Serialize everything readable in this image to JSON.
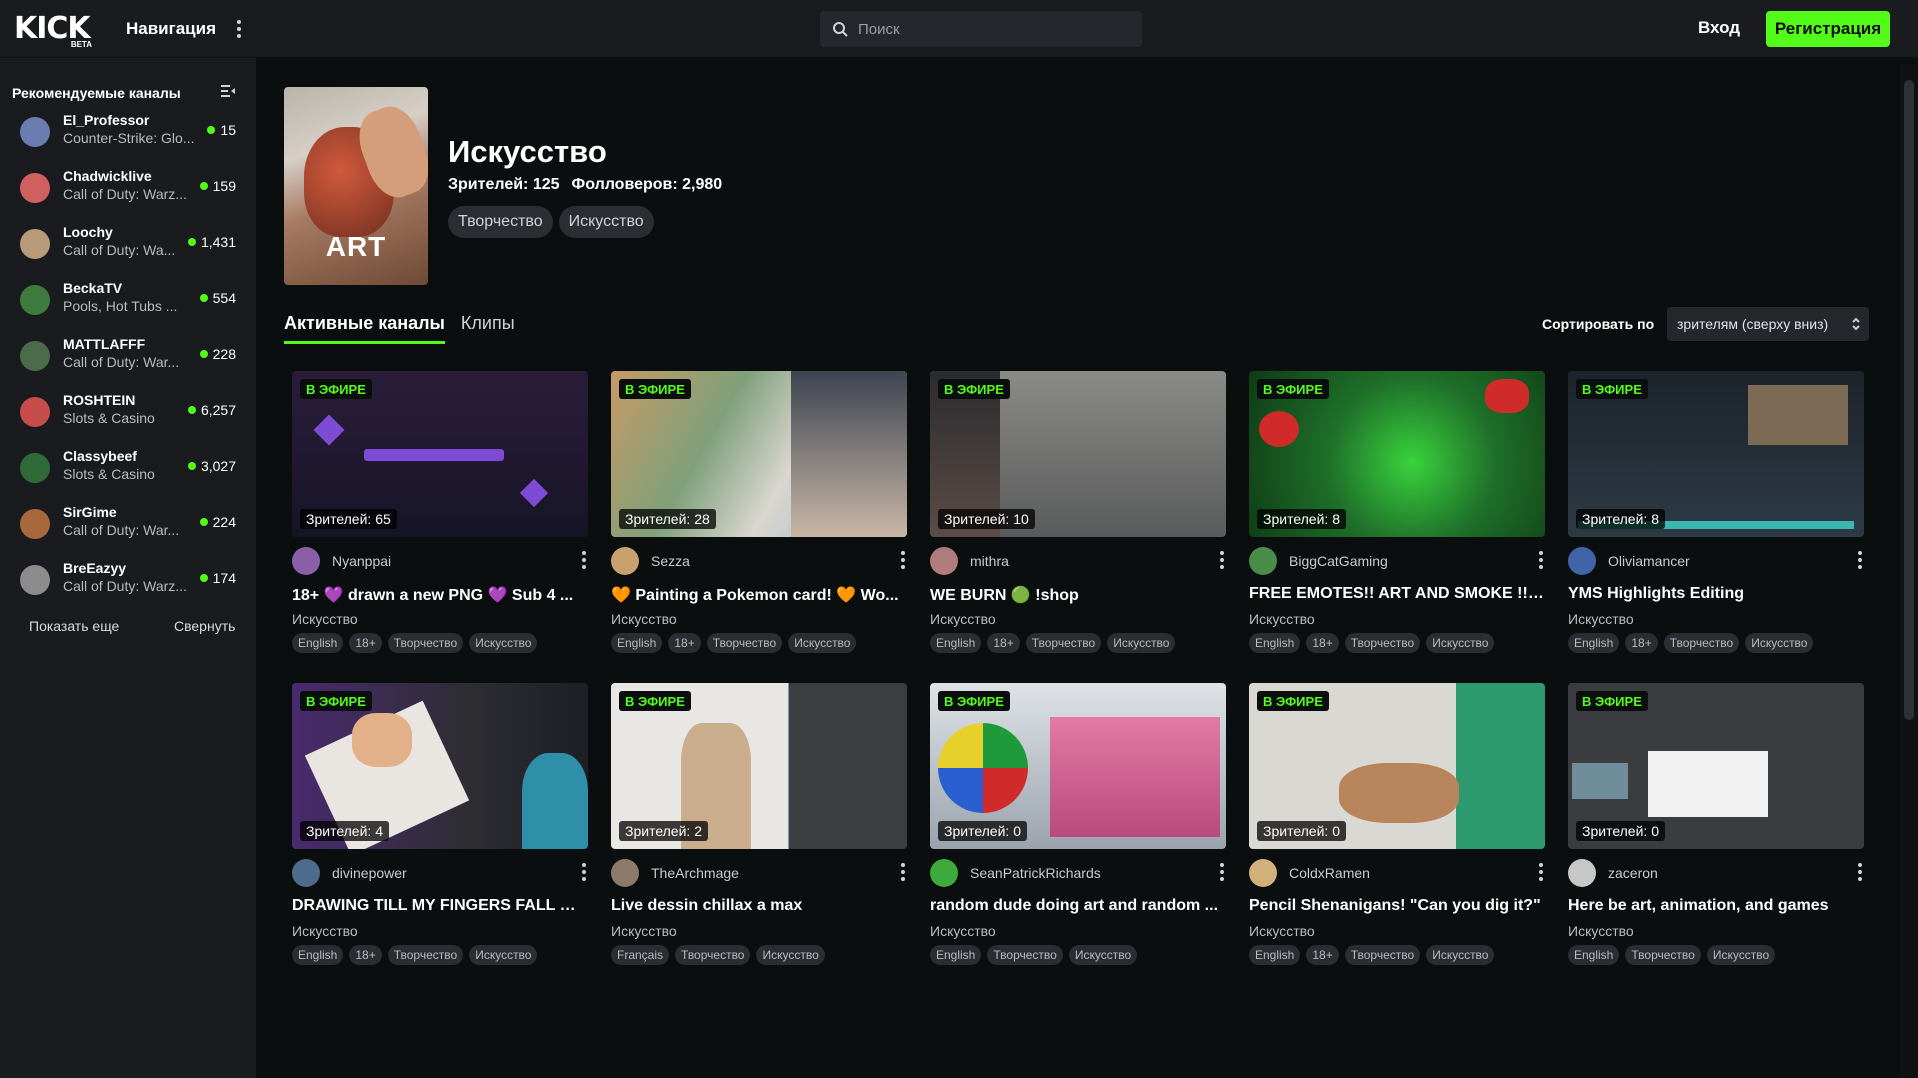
{
  "header": {
    "logo_text": "KICK",
    "logo_beta": "BETA",
    "nav_label": "Навигация",
    "search_placeholder": "Поиск",
    "login": "Вход",
    "register": "Регистрация"
  },
  "sidebar": {
    "title": "Рекомендуемые каналы",
    "items": [
      {
        "name": "El_Professor",
        "game": "Counter-Strike: Glo...",
        "viewers": "15",
        "color": "#6b7db0"
      },
      {
        "name": "Chadwicklive",
        "game": "Call of Duty: Warz...",
        "viewers": "159",
        "color": "#d05f5f"
      },
      {
        "name": "Loochy",
        "game": "Call of Duty: Wa...",
        "viewers": "1,431",
        "color": "#b99a78"
      },
      {
        "name": "BeckaTV",
        "game": "Pools, Hot Tubs ...",
        "viewers": "554",
        "color": "#3e7b3e"
      },
      {
        "name": "MATTLAFFF",
        "game": "Call of Duty: War...",
        "viewers": "228",
        "color": "#4b6b4b"
      },
      {
        "name": "ROSHTEIN",
        "game": "Slots & Casino",
        "viewers": "6,257",
        "color": "#c74d4d"
      },
      {
        "name": "Classybeef",
        "game": "Slots & Casino",
        "viewers": "3,027",
        "color": "#2f6b37"
      },
      {
        "name": "SirGime",
        "game": "Call of Duty: War...",
        "viewers": "224",
        "color": "#a7683c"
      },
      {
        "name": "BreEazyy",
        "game": "Call of Duty: Warz...",
        "viewers": "174",
        "color": "#8c8c8c"
      }
    ],
    "show_more": "Показать еще",
    "collapse": "Свернуть"
  },
  "category": {
    "thumb_label": "ART",
    "title": "Искусство",
    "viewers": "Зрителей: 125",
    "followers": "Фолловеров: 2,980",
    "tags": [
      "Творчество",
      "Искусство"
    ]
  },
  "tabs": [
    "Активные каналы",
    "Клипы"
  ],
  "sort": {
    "label": "Сортировать по",
    "value": "зрителям (сверху вниз)"
  },
  "live_label": "В ЭФИРЕ",
  "streams": [
    {
      "viewers": "Зрителей: 65",
      "channel": "Nyanppai",
      "title": "18+ 💜 drawn a new PNG 💜 Sub 4 ...",
      "category": "Искусство",
      "tags": [
        "English",
        "18+",
        "Творчество",
        "Искусство"
      ],
      "thumb": "#2a1d3a",
      "avatar": "#8b5fa8"
    },
    {
      "viewers": "Зрителей: 28",
      "channel": "Sezza",
      "title": "🧡 Painting a Pokemon card! 🧡 Wo...",
      "category": "Искусство",
      "tags": [
        "English",
        "18+",
        "Творчество",
        "Искусство"
      ],
      "thumb": "#6a8d6b",
      "avatar": "#c8a16c"
    },
    {
      "viewers": "Зрителей: 10",
      "channel": "mithra",
      "title": "WE BURN 🟢 !shop",
      "category": "Искусство",
      "tags": [
        "English",
        "18+",
        "Творчество",
        "Искусство"
      ],
      "thumb": "#56585a",
      "avatar": "#b07c7c"
    },
    {
      "viewers": "Зрителей: 8",
      "channel": "BiggCatGaming",
      "title": "FREE EMOTES!! ART AND SMOKE !!!...",
      "category": "Искусство",
      "tags": [
        "English",
        "18+",
        "Творчество",
        "Искусство"
      ],
      "thumb": "#1f6f2a",
      "avatar": "#4a8d4a"
    },
    {
      "viewers": "Зрителей: 8",
      "channel": "Oliviamancer",
      "title": "YMS Highlights Editing",
      "category": "Искусство",
      "tags": [
        "English",
        "18+",
        "Творчество",
        "Искусство"
      ],
      "thumb": "#24313c",
      "avatar": "#3f65a8"
    },
    {
      "viewers": "Зрителей: 4",
      "channel": "divinepower",
      "title": "DRAWING TILL MY FINGERS FALL OFF",
      "category": "Искусство",
      "tags": [
        "English",
        "18+",
        "Творчество",
        "Искусство"
      ],
      "thumb": "#2f2a3a",
      "avatar": "#4c6b8d"
    },
    {
      "viewers": "Зрителей: 2",
      "channel": "TheArchmage",
      "title": "Live dessin chillax a max",
      "category": "Искусство",
      "tags": [
        "Français",
        "Творчество",
        "Искусство"
      ],
      "thumb": "#4a4b4d",
      "avatar": "#8c7a6a"
    },
    {
      "viewers": "Зрителей: 0",
      "channel": "SeanPatrickRichards",
      "title": "random dude doing art and random ...",
      "category": "Искусство",
      "tags": [
        "English",
        "Творчество",
        "Искусство"
      ],
      "thumb": "#2f3a4a",
      "avatar": "#3caa3c"
    },
    {
      "viewers": "Зрителей: 0",
      "channel": "ColdxRamen",
      "title": "Pencil Shenanigans! \"Can you dig it?\"",
      "category": "Искусство",
      "tags": [
        "English",
        "18+",
        "Творчество",
        "Искусство"
      ],
      "thumb": "#8f8f88",
      "avatar": "#d1b07a"
    },
    {
      "viewers": "Зрителей: 0",
      "channel": "zaceron",
      "title": "Here be art, animation, and games",
      "category": "Искусство",
      "tags": [
        "English",
        "Творчество",
        "Искусство"
      ],
      "thumb": "#3a3c40",
      "avatar": "#c7c7c7"
    }
  ]
}
